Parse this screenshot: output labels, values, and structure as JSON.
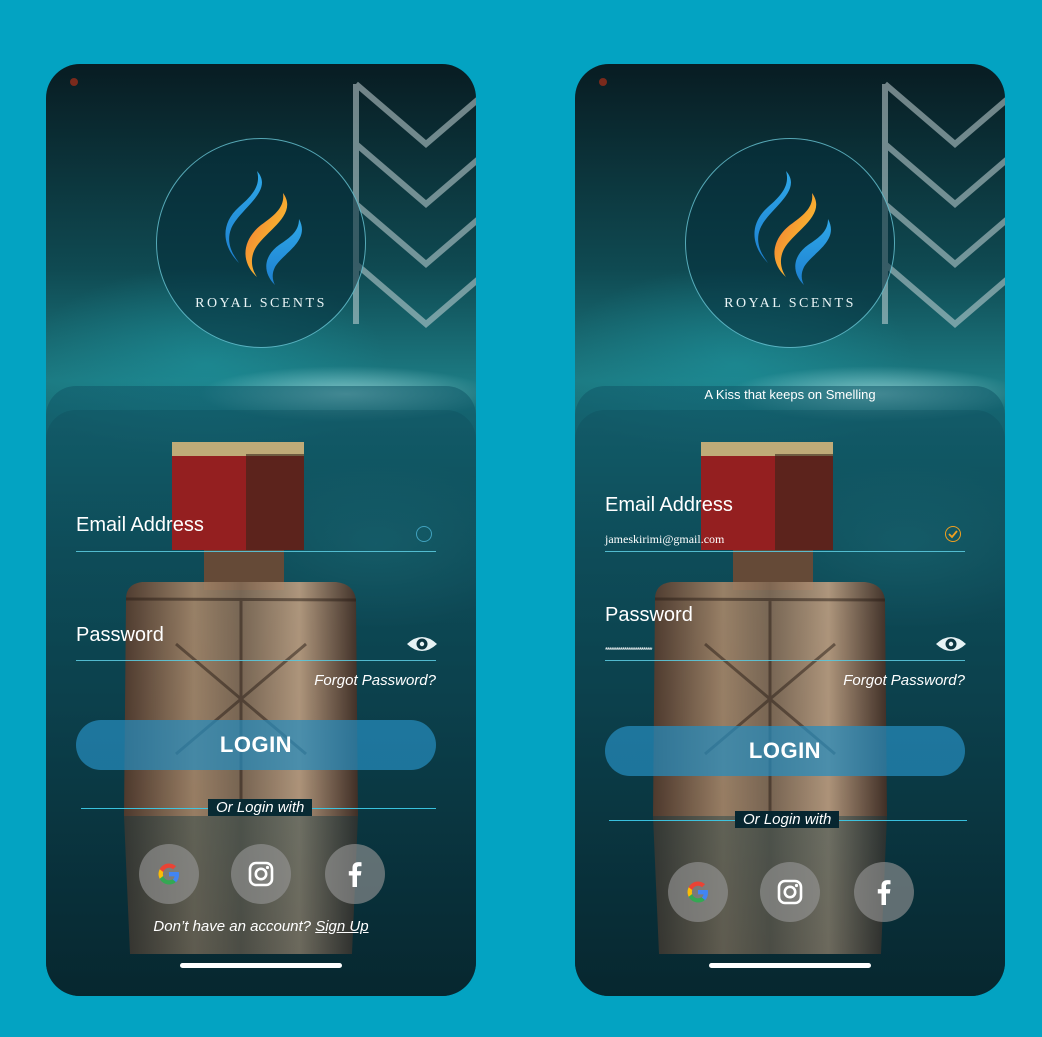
{
  "colors": {
    "background": "#03a3c2",
    "accent": "#268cbe",
    "check": "#f0a020"
  },
  "screens": [
    {
      "brand": "ROYAL SCENTS",
      "tagline": "",
      "email": {
        "label": "Email Address",
        "value": ""
      },
      "password": {
        "label": "Password",
        "value": ""
      },
      "forgot": "Forgot Password?",
      "login": "LOGIN",
      "or_login": "Or Login with",
      "social": [
        "google-icon",
        "instagram-icon",
        "facebook-icon"
      ],
      "signup_prefix": "Don’t have an account?",
      "signup_link": "Sign Up"
    },
    {
      "brand": "ROYAL SCENTS",
      "tagline": "A Kiss that keeps on Smelling",
      "email": {
        "label": "Email Address",
        "value": "jameskirimi@gmail.com"
      },
      "password": {
        "label": "Password",
        "value": "**********************"
      },
      "forgot": "Forgot Password?",
      "login": "LOGIN",
      "or_login": "Or Login with",
      "social": [
        "google-icon",
        "instagram-icon",
        "facebook-icon"
      ]
    }
  ]
}
